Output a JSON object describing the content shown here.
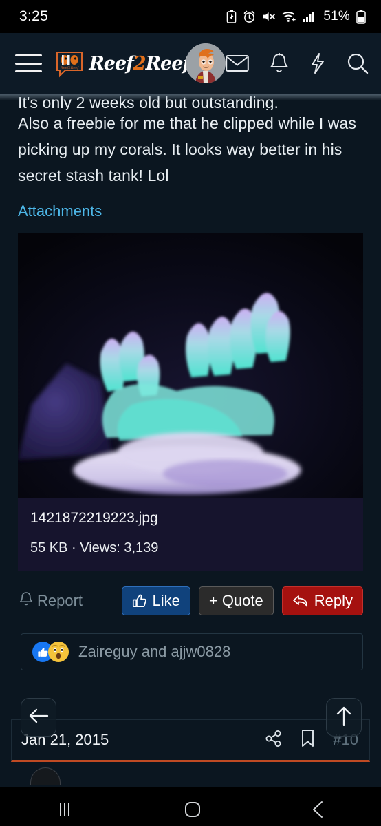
{
  "status_bar": {
    "clock": "3:25",
    "battery_percent": "51%",
    "icons": [
      "battery-saver-icon",
      "alarm-icon",
      "mute-icon",
      "wifi-icon",
      "cell-signal-icon",
      "battery-icon"
    ]
  },
  "header": {
    "menu_icon": "hamburger-menu-icon",
    "brand_word_1": "Reef",
    "brand_two": "2",
    "brand_word_2": "Reef",
    "brand_mark": "clownfish-speech-bubble-icon",
    "avatar": "user-avatar-fry",
    "icons": [
      "mail-icon",
      "bell-icon",
      "lightning-icon",
      "search-icon"
    ]
  },
  "post": {
    "text_clipped": "It's only 2 weeks old but outstanding.",
    "text_line_2": "Also a freebie for me that he clipped",
    "text_line_3": "while I was picking up my corals. It looks",
    "text_line_4": "way better in his secret stash tank! Lol",
    "attachments_label": "Attachments",
    "attachment": {
      "filename": "1421872219223.jpg",
      "meta": "55 KB · Views: 3,139",
      "image_alt": "coral-photo"
    },
    "report_label": "Report",
    "report_icon": "bell-icon",
    "like_label": "Like",
    "like_icon": "thumbs-up-icon",
    "quote_label": "+ Quote",
    "reply_label": "Reply",
    "reply_icon": "reply-arrow-icon",
    "reactions": {
      "emoji": [
        "thumbs-up-reaction",
        "wow-face-reaction"
      ],
      "names": "Zaireguy and ajjw0828"
    },
    "date": "Jan 21, 2015",
    "post_number": "#10",
    "share_icon": "share-icon",
    "bookmark_icon": "bookmark-icon"
  },
  "floating": {
    "back_icon": "arrow-left-icon",
    "up_icon": "arrow-up-icon"
  },
  "nav_bar": {
    "recents_icon": "recents-icon",
    "home_icon": "home-icon",
    "back_icon": "back-chevron-icon"
  },
  "colors": {
    "background": "#0b1620",
    "header_bg": "#0d1a26",
    "link": "#4db7e8",
    "like_button": "#10427c",
    "quote_button": "#2b2b2b",
    "reply_button": "#a5110f",
    "accent_orange": "#bf4a23",
    "brand_orange": "#e2701a"
  }
}
